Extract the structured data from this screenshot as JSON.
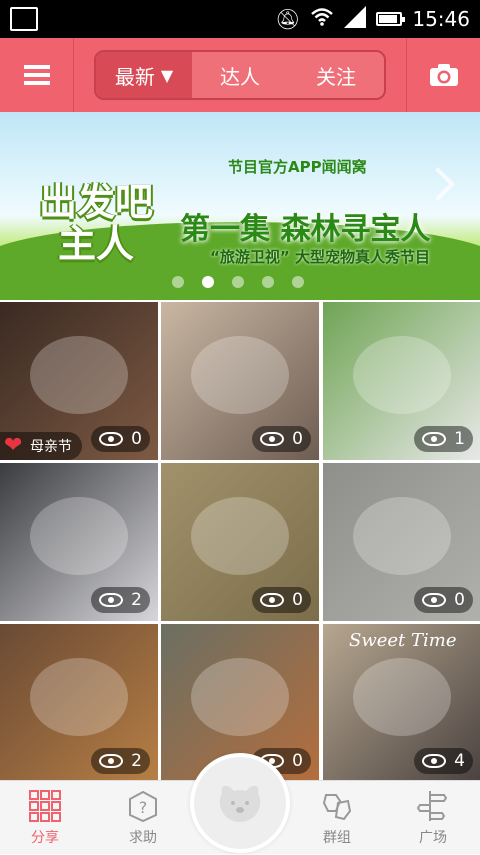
{
  "status_bar": {
    "time": "15:46"
  },
  "header": {
    "tabs": [
      {
        "label": "最新",
        "active": true,
        "has_dropdown": true
      },
      {
        "label": "达人",
        "active": false
      },
      {
        "label": "关注",
        "active": false
      }
    ],
    "camera_icon": "camera-icon",
    "menu_icon": "hamburger-menu-icon"
  },
  "banner": {
    "logo_text": "出发吧主人",
    "headline": "节目官方APP闻闻窝",
    "title": "第一集 森林寻宝人",
    "subtitle": "“旅游卫视” 大型宠物真人秀节目",
    "dots": 5,
    "active_dot": 1
  },
  "grid": [
    {
      "views": "0",
      "tag": "母亲节",
      "colors": [
        "#3a2a22",
        "#7e5a44"
      ]
    },
    {
      "views": "0",
      "colors": [
        "#c9b7a3",
        "#6e5d52"
      ]
    },
    {
      "views": "1",
      "colors": [
        "#6fa454",
        "#e8e8e8"
      ]
    },
    {
      "views": "2",
      "colors": [
        "#3b3c40",
        "#d7d7db"
      ]
    },
    {
      "views": "0",
      "colors": [
        "#a1926c",
        "#7c6e4a"
      ]
    },
    {
      "views": "0",
      "colors": [
        "#8e8f8a",
        "#b0b1ac"
      ]
    },
    {
      "views": "2",
      "colors": [
        "#6a4a34",
        "#b77f45"
      ]
    },
    {
      "views": "0",
      "colors": [
        "#6b6f63",
        "#b46e3c"
      ]
    },
    {
      "views": "4",
      "sticker": "Sweet Time",
      "colors": [
        "#b7a790",
        "#4a4240"
      ]
    }
  ],
  "bottom_nav": [
    {
      "label": "分享",
      "icon": "grid-share-icon",
      "active": true
    },
    {
      "label": "求助",
      "icon": "question-box-icon",
      "active": false
    },
    {
      "label": "",
      "icon": "dog-face-icon",
      "active": false
    },
    {
      "label": "群组",
      "icon": "group-icon",
      "active": false
    },
    {
      "label": "广场",
      "icon": "plaza-icon",
      "active": false
    }
  ]
}
